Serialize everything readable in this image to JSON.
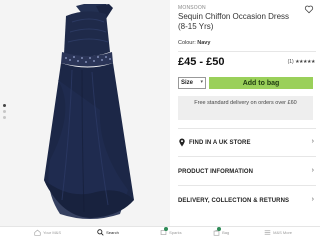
{
  "product": {
    "brand": "MONSOON",
    "title": "Sequin Chiffon Occasion Dress (8-15 Yrs)",
    "colour_label": "Colour:",
    "colour_value": "Navy",
    "price": "£45 - £50",
    "review_count": "(1)",
    "stars": "★★★★★",
    "rating": 5,
    "size_label": "Size",
    "add_to_bag_label": "Add to bag",
    "delivery_text": "Free standard delivery on orders over £60"
  },
  "gallery": {
    "image_count": 3,
    "active_index": 0,
    "dress_color": "#1f2a4a"
  },
  "sections": [
    {
      "label": "FIND IN A UK STORE"
    },
    {
      "label": "PRODUCT INFORMATION"
    },
    {
      "label": "DELIVERY, COLLECTION & RETURNS"
    }
  ],
  "tabbar": {
    "home": "Your M&S",
    "search": "Search",
    "saved": "Sparks",
    "bag": "Bag",
    "more": "M&S More"
  },
  "colors": {
    "accent_green": "#9ad05a",
    "badge_green": "#2e8b57"
  }
}
